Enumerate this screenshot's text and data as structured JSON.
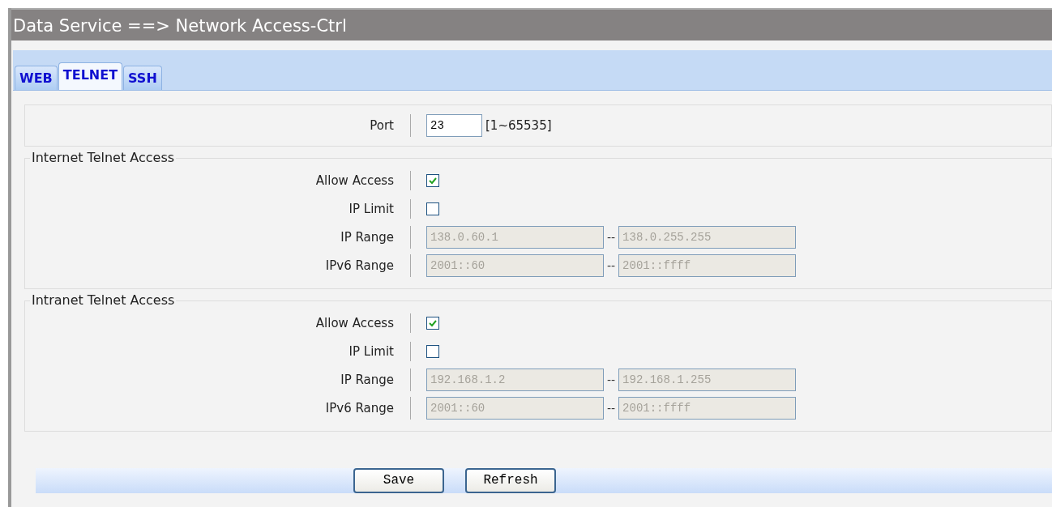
{
  "title": "Data Service ==> Network Access-Ctrl",
  "tabs": [
    {
      "label": "WEB",
      "selected": false
    },
    {
      "label": "TELNET",
      "selected": true
    },
    {
      "label": "SSH",
      "selected": false
    }
  ],
  "port": {
    "label": "Port",
    "value": "23",
    "hint": "[1~65535]"
  },
  "sections": [
    {
      "legend": "Internet Telnet Access",
      "rows": [
        {
          "kind": "checkbox",
          "label": "Allow Access",
          "checked": true
        },
        {
          "kind": "checkbox",
          "label": "IP Limit",
          "checked": false
        },
        {
          "kind": "range",
          "label": "IP Range",
          "from": "138.0.60.1",
          "separator": "--",
          "to": "138.0.255.255",
          "disabled": true
        },
        {
          "kind": "range",
          "label": "IPv6 Range",
          "from": "2001::60",
          "separator": "--",
          "to": "2001::ffff",
          "disabled": true
        }
      ]
    },
    {
      "legend": "Intranet Telnet Access",
      "rows": [
        {
          "kind": "checkbox",
          "label": "Allow Access",
          "checked": true
        },
        {
          "kind": "checkbox",
          "label": "IP Limit",
          "checked": false
        },
        {
          "kind": "range",
          "label": "IP Range",
          "from": "192.168.1.2",
          "separator": "--",
          "to": "192.168.1.255",
          "disabled": true
        },
        {
          "kind": "range",
          "label": "IPv6 Range",
          "from": "2001::60",
          "separator": "--",
          "to": "2001::ffff",
          "disabled": true
        }
      ]
    }
  ],
  "buttons": [
    "Save",
    "Refresh"
  ]
}
